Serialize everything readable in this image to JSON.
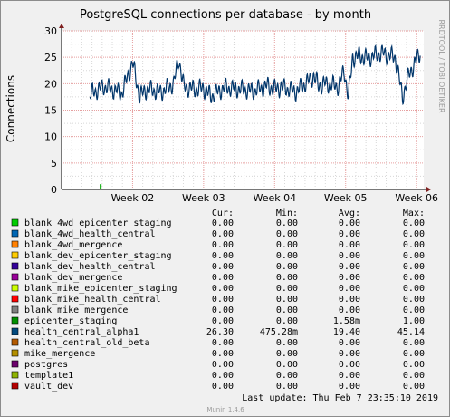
{
  "chart_data": {
    "type": "line",
    "title": "PostgreSQL connections per database - by month",
    "ylabel": "Connections",
    "xlabel": "",
    "watermark": "RRDTOOL / TOBI OETIKER",
    "ylim": [
      0,
      30
    ],
    "yticks": [
      0,
      5,
      10,
      15,
      20,
      25,
      30
    ],
    "xticks": [
      "Week 02",
      "Week 03",
      "Week 04",
      "Week 05",
      "Week 06"
    ],
    "grid": true,
    "colors": {
      "background": "#f0f0f0",
      "canvas": "#ffffff",
      "major_grid": "#e6a0a0",
      "minor_grid": "#d8d8d8",
      "line": "#00356a"
    },
    "series": [
      {
        "name": "health_central_alpha1",
        "color": "#00356a",
        "x_week": [
          1.4,
          1.6,
          1.85,
          2.0,
          2.1,
          2.2,
          2.4,
          2.58,
          2.65,
          2.72,
          2.9,
          3.0,
          3.1,
          3.3,
          3.5,
          3.7,
          3.9,
          4.0,
          4.1,
          4.3,
          4.48,
          4.55,
          4.62,
          4.7,
          4.9,
          4.98,
          5.04,
          5.1,
          5.2,
          5.3,
          5.5,
          5.7,
          5.8,
          5.9,
          6.0,
          6.05
        ],
        "values": [
          18.0,
          19.5,
          18.2,
          24.0,
          17.6,
          19.0,
          18.4,
          20.0,
          24.8,
          19.4,
          18.9,
          19.2,
          17.6,
          19.3,
          19.0,
          18.6,
          19.6,
          19.0,
          19.4,
          18.5,
          20.5,
          21.5,
          19.6,
          20.0,
          19.5,
          22.5,
          17.5,
          25.0,
          25.3,
          24.8,
          25.8,
          25.0,
          17.5,
          22.0,
          24.5,
          26.0
        ]
      },
      {
        "name": "epicenter_staging",
        "color": "#00aa00",
        "x_week": [
          1.55
        ],
        "values": [
          1.0
        ]
      }
    ]
  },
  "legend": {
    "headers": {
      "cur": "Cur:",
      "min": "Min:",
      "avg": "Avg:",
      "max": "Max:"
    },
    "rows": [
      {
        "name": "blank_4wd_epicenter_staging",
        "color": "#00cc00",
        "cur": "0.00",
        "min": "0.00",
        "avg": "0.00",
        "max": "0.00"
      },
      {
        "name": "blank_4wd_health_central",
        "color": "#0066b3",
        "cur": "0.00",
        "min": "0.00",
        "avg": "0.00",
        "max": "0.00"
      },
      {
        "name": "blank_4wd_mergence",
        "color": "#ff8000",
        "cur": "0.00",
        "min": "0.00",
        "avg": "0.00",
        "max": "0.00"
      },
      {
        "name": "blank_dev_epicenter_staging",
        "color": "#ffcc00",
        "cur": "0.00",
        "min": "0.00",
        "avg": "0.00",
        "max": "0.00"
      },
      {
        "name": "blank_dev_health_central",
        "color": "#330099",
        "cur": "0.00",
        "min": "0.00",
        "avg": "0.00",
        "max": "0.00"
      },
      {
        "name": "blank_dev_mergence",
        "color": "#990099",
        "cur": "0.00",
        "min": "0.00",
        "avg": "0.00",
        "max": "0.00"
      },
      {
        "name": "blank_mike_epicenter_staging",
        "color": "#ccff00",
        "cur": "0.00",
        "min": "0.00",
        "avg": "0.00",
        "max": "0.00"
      },
      {
        "name": "blank_mike_health_central",
        "color": "#ff0000",
        "cur": "0.00",
        "min": "0.00",
        "avg": "0.00",
        "max": "0.00"
      },
      {
        "name": "blank_mike_mergence",
        "color": "#808080",
        "cur": "0.00",
        "min": "0.00",
        "avg": "0.00",
        "max": "0.00"
      },
      {
        "name": "epicenter_staging",
        "color": "#008f00",
        "cur": "0.00",
        "min": "0.00",
        "avg": "1.58m",
        "max": "1.00"
      },
      {
        "name": "health_central_alpha1",
        "color": "#00487d",
        "cur": "26.30",
        "min": "475.28m",
        "avg": "19.40",
        "max": "45.14"
      },
      {
        "name": "health_central_old_beta",
        "color": "#b35a00",
        "cur": "0.00",
        "min": "0.00",
        "avg": "0.00",
        "max": "0.00"
      },
      {
        "name": "mike_mergence",
        "color": "#b38f00",
        "cur": "0.00",
        "min": "0.00",
        "avg": "0.00",
        "max": "0.00"
      },
      {
        "name": "postgres",
        "color": "#6b006b",
        "cur": "0.00",
        "min": "0.00",
        "avg": "0.00",
        "max": "0.00"
      },
      {
        "name": "template1",
        "color": "#8fb300",
        "cur": "0.00",
        "min": "0.00",
        "avg": "0.00",
        "max": "0.00"
      },
      {
        "name": "vault_dev",
        "color": "#b30000",
        "cur": "0.00",
        "min": "0.00",
        "avg": "0.00",
        "max": "0.00"
      }
    ]
  },
  "footer": {
    "last_update": "Last update:  Thu Feb  7 23:35:10 2019",
    "version": "Munin 1.4.6"
  }
}
